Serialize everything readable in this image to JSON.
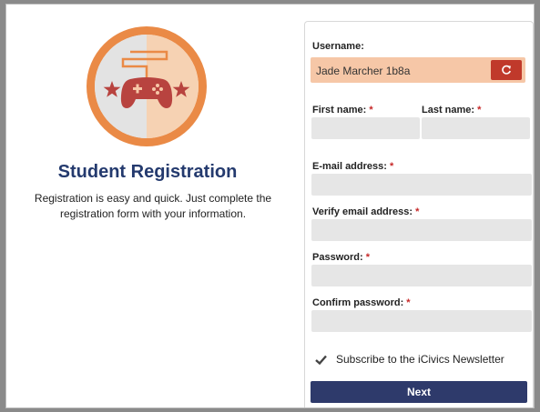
{
  "left": {
    "title": "Student Registration",
    "description": "Registration is easy and quick. Just complete the registration form with your information."
  },
  "form": {
    "username_label": "Username:",
    "username_value": "Jade Marcher 1b8a",
    "refresh_icon": "refresh-icon",
    "first_name_label": "First name:",
    "last_name_label": "Last name:",
    "email_label": "E-mail address:",
    "verify_email_label": "Verify email address:",
    "password_label": "Password:",
    "confirm_password_label": "Confirm password:",
    "required_mark": "*",
    "newsletter_label": "Subscribe to the iCivics Newsletter",
    "newsletter_checked": true,
    "next_label": "Next"
  },
  "colors": {
    "accent_orange": "#ea8a46",
    "username_bg": "#f6c7a7",
    "refresh_red": "#c0392b",
    "title_navy": "#243a6e",
    "button_navy": "#2e3a6b",
    "required_red": "#c62828",
    "controller_red": "#b8433f"
  }
}
